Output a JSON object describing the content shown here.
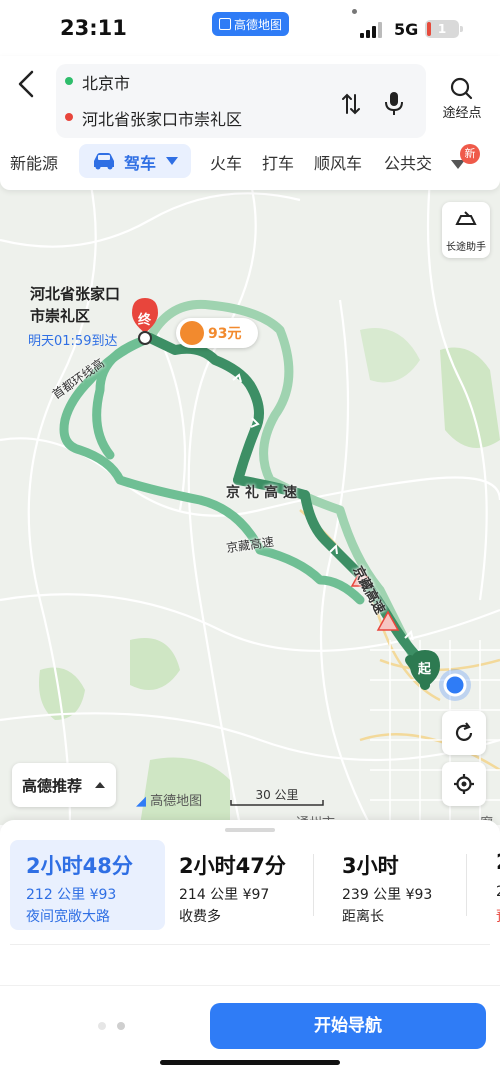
{
  "status": {
    "time": "23:11",
    "app_badge": "高德地图",
    "network": "5G",
    "battery": "1"
  },
  "header": {
    "origin": "北京市",
    "destination": "河北省张家口市崇礼区",
    "via_label": "途经点",
    "modes": [
      {
        "label": "新能源"
      },
      {
        "label": "驾车"
      },
      {
        "label": "火车"
      },
      {
        "label": "打车"
      },
      {
        "label": "顺风车"
      },
      {
        "label": "公共交"
      }
    ],
    "new_badge": "新",
    "colors": {
      "origin_dot": "#2ebd6b",
      "destination_dot": "#e8453c",
      "accent": "#2f6fe4"
    }
  },
  "map": {
    "destination_label": "河北省张家口\n市崇礼区",
    "eta": "明天01:59到达",
    "end_marker": "终",
    "start_marker": "起",
    "toll": "93元",
    "roads": [
      "京礼高速",
      "京藏高速",
      "首都环线高",
      "京藏高速"
    ],
    "long_trip_label": "长途助手",
    "recommend_label": "高德推荐",
    "watermark": "高德地图",
    "scale": "30 公里",
    "city_fragment": "通州市",
    "city_fragment2": "廊"
  },
  "routes": [
    {
      "time": "2小时48分",
      "info": "212 公里  ¥93",
      "tag": "夜间宽敞大路",
      "selected": true
    },
    {
      "time": "2小时47分",
      "info": "214 公里  ¥97",
      "tag": "收费多",
      "selected": false
    },
    {
      "time": "3小时",
      "info": "239 公里  ¥93",
      "tag": "距离长",
      "selected": false
    },
    {
      "time": "2",
      "info": "2",
      "tag": "预",
      "selected": false
    }
  ],
  "bottom": {
    "start_nav": "开始导航"
  }
}
